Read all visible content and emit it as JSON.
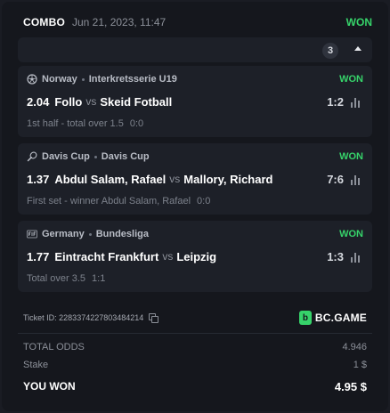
{
  "bet": {
    "type": "COMBO",
    "datetime": "Jun 21, 2023, 11:47",
    "status": "WON",
    "selection_count": "3"
  },
  "events": [
    {
      "sport_icon": "soccer-ball-icon",
      "country": "Norway",
      "league": "Interkretsserie U19",
      "status": "WON",
      "odds": "2.04",
      "home": "Follo",
      "vs": "vs",
      "away": "Skeid Fotball",
      "score": "1:2",
      "market": "1st half - total over 1.5",
      "result": "0:0"
    },
    {
      "sport_icon": "tennis-racket-icon",
      "country": "Davis Cup",
      "league": "Davis Cup",
      "status": "WON",
      "odds": "1.37",
      "home": "Abdul Salam, Rafael",
      "vs": "vs",
      "away": "Mallory, Richard",
      "score": "7:6",
      "market": "First set - winner Abdul Salam, Rafael",
      "result": "0:0"
    },
    {
      "sport_icon": "fifa-icon",
      "country": "Germany",
      "league": "Bundesliga",
      "status": "WON",
      "odds": "1.77",
      "home": "Eintracht Frankfurt",
      "vs": "vs",
      "away": "Leipzig",
      "score": "1:3",
      "market": "Total over 3.5",
      "result": "1:1"
    }
  ],
  "ticket": {
    "label": "Ticket ID: 2283374227803484214"
  },
  "brand": {
    "logo_letter": "b",
    "name": "BC.GAME"
  },
  "summary": {
    "total_odds_label": "TOTAL ODDS",
    "total_odds_value": "4.946",
    "stake_label": "Stake",
    "stake_value": "1 $",
    "won_label": "YOU WON",
    "won_value": "4.95 $"
  },
  "colors": {
    "won_green": "#36d36a",
    "panel": "#1d2028",
    "background": "#15171d"
  }
}
